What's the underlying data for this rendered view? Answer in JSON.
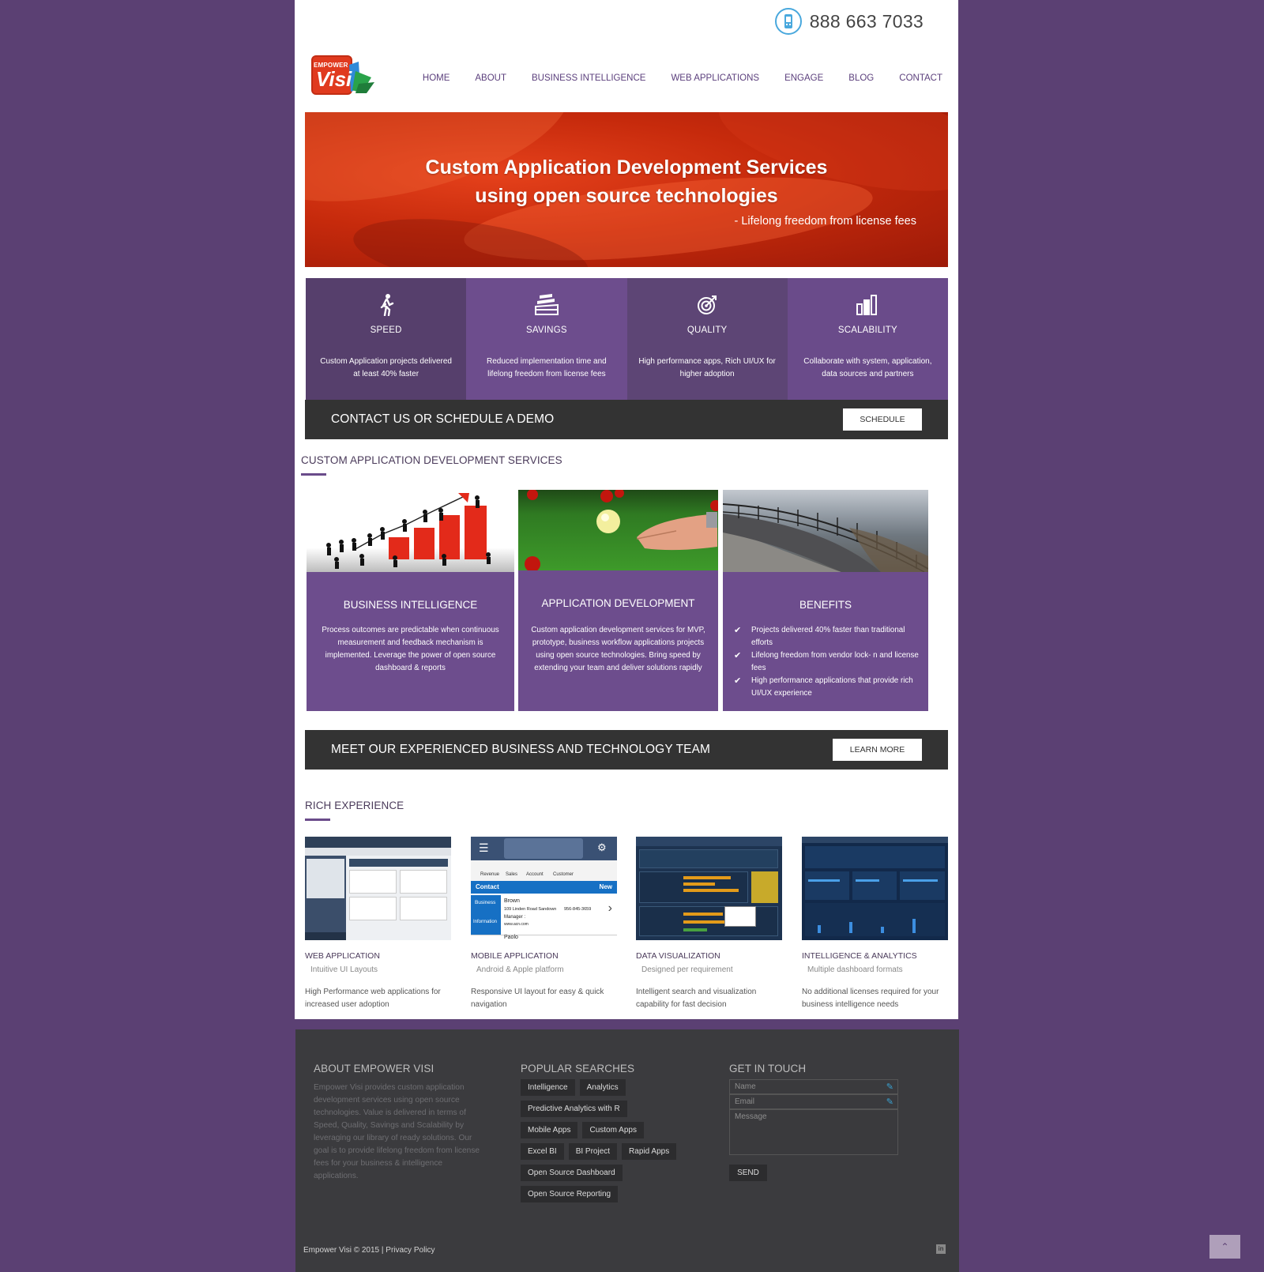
{
  "header": {
    "phone": "888 663 7033",
    "logo_top": "EMPOWER",
    "logo_main": "Visi",
    "nav": [
      "HOME",
      "ABOUT",
      "BUSINESS INTELLIGENCE",
      "WEB APPLICATIONS",
      "ENGAGE",
      "BLOG",
      "CONTACT"
    ]
  },
  "banner": {
    "line1": "Custom Application Development Services",
    "line2": "using open source technologies",
    "tagline": "- Lifelong freedom from license fees"
  },
  "features": [
    {
      "icon": "walking-person-icon",
      "title": "SPEED",
      "text": "Custom Application projects delivered at least 40% faster"
    },
    {
      "icon": "stack-of-bills-icon",
      "title": "SAVINGS",
      "text": "Reduced implementation time and lifelong freedom from license fees"
    },
    {
      "icon": "target-icon",
      "title": "QUALITY",
      "text": "High performance apps, Rich UI/UX for higher adoption"
    },
    {
      "icon": "bar-chart-icon",
      "title": "SCALABILITY",
      "text": "Collaborate with system, application, data sources and partners"
    }
  ],
  "cta_schedule": {
    "text": "CONTACT US OR SCHEDULE A DEMO",
    "button": "SCHEDULE"
  },
  "services": {
    "title": "CUSTOM APPLICATION DEVELOPMENT SERVICES",
    "cards": [
      {
        "title": "BUSINESS INTELLIGENCE",
        "text": "Process outcomes are predictable when continuous measurement and feedback mechanism is implemented. Leverage the power of open source dashboard & reports"
      },
      {
        "title": "APPLICATION DEVELOPMENT",
        "text": "Custom application development services for MVP, prototype, business workflow applications projects using open source technologies. Bring speed by extending your team and deliver solutions rapidly"
      },
      {
        "title": "BENEFITS",
        "items": [
          "Projects delivered 40% faster than traditional efforts",
          "Lifelong freedom from vendor lock- n and license fees",
          "High performance applications that provide rich UI/UX experience"
        ]
      }
    ]
  },
  "cta_team": {
    "text": "MEET OUR EXPERIENCED BUSINESS AND TECHNOLOGY TEAM",
    "button": "LEARN MORE"
  },
  "rich": {
    "title": "RICH EXPERIENCE",
    "items": [
      {
        "title": "WEB APPLICATION",
        "sub": "Intuitive UI Layouts",
        "text": "High Performance web applications for increased user adoption"
      },
      {
        "title": "MOBILE APPLICATION",
        "sub": "Android & Apple platform",
        "text": "Responsive UI layout for easy & quick navigation"
      },
      {
        "title": "DATA VISUALIZATION",
        "sub": "Designed per requirement",
        "text": "Intelligent search and visualization capability for fast decision"
      },
      {
        "title": "INTELLIGENCE & ANALYTICS",
        "sub": "Multiple dashboard formats",
        "text": "No additional licenses required for your business intelligence needs"
      }
    ],
    "mobile": {
      "contact": "Contact",
      "new": "New",
      "name": "Brown",
      "addr": "109 Linden Road Sandown",
      "phone": "956-845-3659",
      "manager": "Manager :",
      "site": "www.acn.com",
      "business": "Business",
      "info": "Information",
      "next": "Paolo",
      "tabs": [
        "Revenue",
        "Sales",
        "Account",
        "Customer"
      ]
    }
  },
  "footer": {
    "about_title": "ABOUT EMPOWER VISI",
    "about_text": "Empower Visi provides custom application development services using open source technologies. Value is delivered in terms of Speed, Quality, Savings and Scalability by leveraging our library of ready solutions. Our goal is to provide lifelong freedom from license fees for your business & intelligence applications.",
    "searches_title": "POPULAR SEARCHES",
    "searches": [
      [
        "Intelligence",
        "Analytics"
      ],
      [
        "Predictive Analytics with R"
      ],
      [
        "Mobile Apps",
        "Custom Apps"
      ],
      [
        "Excel BI",
        "BI Project",
        "Rapid Apps"
      ],
      [
        "Open Source Dashboard"
      ],
      [
        "Open Source Reporting"
      ]
    ],
    "contact_title": "GET IN TOUCH",
    "name_ph": "Name",
    "email_ph": "Email",
    "message_ph": "Message",
    "send": "SEND",
    "copyright": "Empower Visi © 2015 | Privacy Policy",
    "linkedin": "in"
  }
}
